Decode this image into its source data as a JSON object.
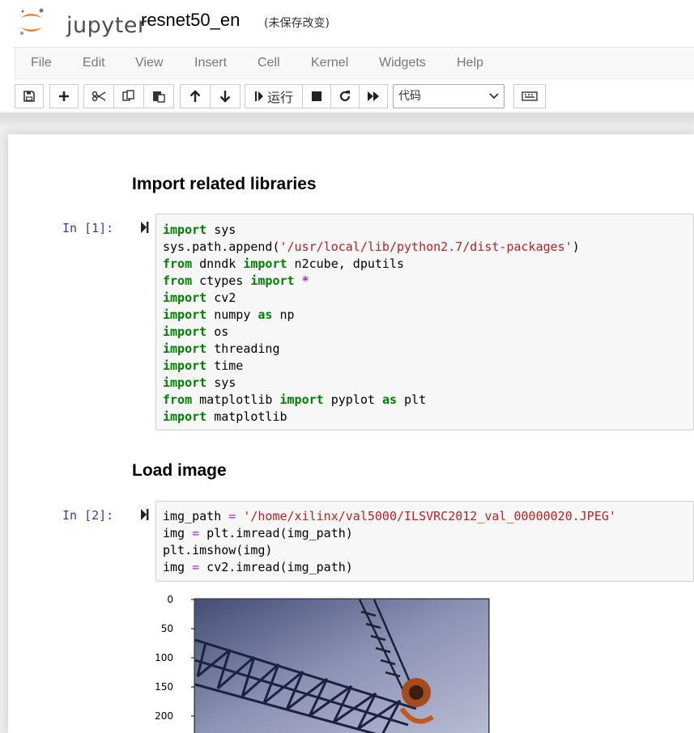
{
  "header": {
    "logo_text": "jupyter",
    "notebook_name": "resnet50_en",
    "save_status": "(未保存改变)"
  },
  "menu": {
    "items": [
      "File",
      "Edit",
      "View",
      "Insert",
      "Cell",
      "Kernel",
      "Widgets",
      "Help"
    ]
  },
  "toolbar": {
    "run_label": "运行",
    "cell_type": "代码",
    "icons": [
      "save-icon",
      "plus-icon",
      "cut-icon",
      "copy-icon",
      "paste-icon",
      "arrow-up-icon",
      "arrow-down-icon",
      "run-icon",
      "stop-icon",
      "restart-icon",
      "fast-forward-icon",
      "keyboard-icon"
    ]
  },
  "cells": {
    "md1": {
      "text": "Import related libraries"
    },
    "code1": {
      "prompt": "In  [1]:",
      "lines": [
        [
          [
            "kw",
            "import"
          ],
          [
            "t",
            " sys"
          ]
        ],
        [
          [
            "t",
            "sys.path.append("
          ],
          [
            "str",
            "'/usr/local/lib/python2.7/dist-packages'"
          ],
          [
            "t",
            ")"
          ]
        ],
        [
          [
            "kw",
            "from"
          ],
          [
            "t",
            " dnndk "
          ],
          [
            "kw",
            "import"
          ],
          [
            "t",
            " n2cube, dputils"
          ]
        ],
        [
          [
            "kw",
            "from"
          ],
          [
            "t",
            " ctypes "
          ],
          [
            "kw",
            "import"
          ],
          [
            "t",
            " "
          ],
          [
            "op",
            "*"
          ]
        ],
        [
          [
            "kw",
            "import"
          ],
          [
            "t",
            " cv2"
          ]
        ],
        [
          [
            "kw",
            "import"
          ],
          [
            "t",
            " numpy "
          ],
          [
            "kw",
            "as"
          ],
          [
            "t",
            " np"
          ]
        ],
        [
          [
            "kw",
            "import"
          ],
          [
            "t",
            " os"
          ]
        ],
        [
          [
            "kw",
            "import"
          ],
          [
            "t",
            " threading"
          ]
        ],
        [
          [
            "kw",
            "import"
          ],
          [
            "t",
            " time"
          ]
        ],
        [
          [
            "kw",
            "import"
          ],
          [
            "t",
            " sys"
          ]
        ],
        [
          [
            "kw",
            "from"
          ],
          [
            "t",
            " matplotlib "
          ],
          [
            "kw",
            "import"
          ],
          [
            "t",
            " pyplot "
          ],
          [
            "kw",
            "as"
          ],
          [
            "t",
            " plt"
          ]
        ],
        [
          [
            "kw",
            "import"
          ],
          [
            "t",
            " matplotlib"
          ]
        ]
      ]
    },
    "md2": {
      "text": "Load image"
    },
    "code2": {
      "prompt": "In  [2]:",
      "lines": [
        [
          [
            "t",
            "img_path "
          ],
          [
            "eq",
            "="
          ],
          [
            "t",
            " "
          ],
          [
            "str",
            "'/home/xilinx/val5000/ILSVRC2012_val_00000020.JPEG'"
          ]
        ],
        [
          [
            "t",
            "img "
          ],
          [
            "eq",
            "="
          ],
          [
            "t",
            " plt.imread(img_path)"
          ]
        ],
        [
          [
            "t",
            "plt.imshow(img)"
          ]
        ],
        [
          [
            "t",
            "img "
          ],
          [
            "eq",
            "="
          ],
          [
            "t",
            " cv2.imread(img_path)"
          ]
        ]
      ]
    },
    "output": {
      "yticks": [
        "0",
        "50",
        "100",
        "150",
        "200"
      ]
    }
  },
  "colors": {
    "keyword": "#008000",
    "string": "#ba2121",
    "operator": "#aa22ff",
    "prompt": "#303f9f",
    "logo_orange": "#f37726"
  }
}
